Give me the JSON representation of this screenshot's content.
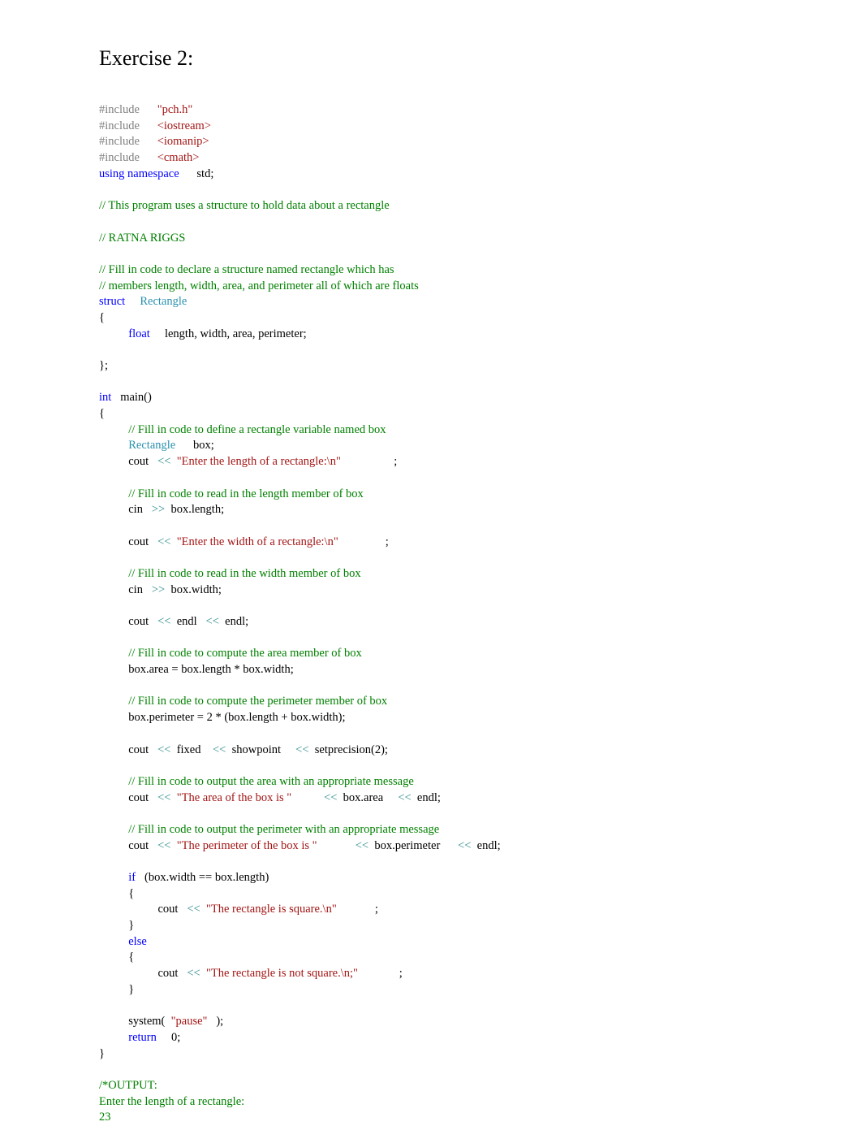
{
  "document": {
    "title": "Exercise 2:",
    "language": "cpp",
    "background_color": "#ffffff"
  },
  "syntax_colors": {
    "preprocessor": "#808080",
    "string": "#A31515",
    "keyword": "#0000FF",
    "type": "#2B91AF",
    "comment": "#008000",
    "operator": "#2E8B8B",
    "plain": "#000000"
  },
  "code": {
    "lines": [
      {
        "tokens": [
          {
            "t": "#include",
            "c": "pre"
          },
          {
            "t": "      ",
            "c": "plain"
          },
          {
            "t": "\"pch.h\"",
            "c": "str"
          }
        ]
      },
      {
        "tokens": [
          {
            "t": "#include",
            "c": "pre"
          },
          {
            "t": "      ",
            "c": "plain"
          },
          {
            "t": "<iostream>",
            "c": "str"
          }
        ]
      },
      {
        "tokens": [
          {
            "t": "#include",
            "c": "pre"
          },
          {
            "t": "      ",
            "c": "plain"
          },
          {
            "t": "<iomanip>",
            "c": "str"
          }
        ]
      },
      {
        "tokens": [
          {
            "t": "#include",
            "c": "pre"
          },
          {
            "t": "      ",
            "c": "plain"
          },
          {
            "t": "<cmath>",
            "c": "str"
          }
        ]
      },
      {
        "tokens": [
          {
            "t": "using namespace",
            "c": "kw"
          },
          {
            "t": "      ",
            "c": "plain"
          },
          {
            "t": "std;",
            "c": "plain"
          }
        ]
      },
      {
        "tokens": []
      },
      {
        "tokens": [
          {
            "t": "// This program uses a structure to hold data about a rectangle",
            "c": "cmt"
          }
        ]
      },
      {
        "tokens": []
      },
      {
        "tokens": [
          {
            "t": "// RATNA RIGGS",
            "c": "cmt"
          }
        ]
      },
      {
        "tokens": []
      },
      {
        "tokens": [
          {
            "t": "// Fill in code to declare a structure named rectangle which has",
            "c": "cmt"
          }
        ]
      },
      {
        "tokens": [
          {
            "t": "// members length, width, area, and perimeter all of which are floats",
            "c": "cmt"
          }
        ]
      },
      {
        "tokens": [
          {
            "t": "struct",
            "c": "kw"
          },
          {
            "t": "     ",
            "c": "plain"
          },
          {
            "t": "Rectangle",
            "c": "type"
          }
        ]
      },
      {
        "tokens": [
          {
            "t": "{",
            "c": "plain"
          }
        ]
      },
      {
        "tokens": [
          {
            "t": "          ",
            "c": "plain"
          },
          {
            "t": "float",
            "c": "kw"
          },
          {
            "t": "     ",
            "c": "plain"
          },
          {
            "t": "length, width, area, perimeter;",
            "c": "plain"
          }
        ]
      },
      {
        "tokens": []
      },
      {
        "tokens": [
          {
            "t": "};",
            "c": "plain"
          }
        ]
      },
      {
        "tokens": []
      },
      {
        "tokens": [
          {
            "t": "int",
            "c": "kw"
          },
          {
            "t": "   ",
            "c": "plain"
          },
          {
            "t": "main()",
            "c": "plain"
          }
        ]
      },
      {
        "tokens": [
          {
            "t": "{",
            "c": "plain"
          }
        ]
      },
      {
        "tokens": [
          {
            "t": "          ",
            "c": "plain"
          },
          {
            "t": "// Fill in code to define a rectangle variable named box",
            "c": "cmt"
          }
        ]
      },
      {
        "tokens": [
          {
            "t": "          ",
            "c": "plain"
          },
          {
            "t": "Rectangle",
            "c": "type"
          },
          {
            "t": "      ",
            "c": "plain"
          },
          {
            "t": "box;",
            "c": "plain"
          }
        ]
      },
      {
        "tokens": [
          {
            "t": "          ",
            "c": "plain"
          },
          {
            "t": "cout",
            "c": "plain"
          },
          {
            "t": "   ",
            "c": "plain"
          },
          {
            "t": "<<",
            "c": "op"
          },
          {
            "t": "  ",
            "c": "plain"
          },
          {
            "t": "\"Enter the length of a rectangle:\\n\"",
            "c": "str"
          },
          {
            "t": "                  ",
            "c": "plain"
          },
          {
            "t": ";",
            "c": "plain"
          }
        ]
      },
      {
        "tokens": []
      },
      {
        "tokens": [
          {
            "t": "          ",
            "c": "plain"
          },
          {
            "t": "// Fill in code to read in the length member of box",
            "c": "cmt"
          }
        ]
      },
      {
        "tokens": [
          {
            "t": "          ",
            "c": "plain"
          },
          {
            "t": "cin",
            "c": "plain"
          },
          {
            "t": "   ",
            "c": "plain"
          },
          {
            "t": ">>",
            "c": "op"
          },
          {
            "t": "  ",
            "c": "plain"
          },
          {
            "t": "box.length;",
            "c": "plain"
          }
        ]
      },
      {
        "tokens": []
      },
      {
        "tokens": [
          {
            "t": "          ",
            "c": "plain"
          },
          {
            "t": "cout",
            "c": "plain"
          },
          {
            "t": "   ",
            "c": "plain"
          },
          {
            "t": "<<",
            "c": "op"
          },
          {
            "t": "  ",
            "c": "plain"
          },
          {
            "t": "\"Enter the width of a rectangle:\\n\"",
            "c": "str"
          },
          {
            "t": "                ",
            "c": "plain"
          },
          {
            "t": ";",
            "c": "plain"
          }
        ]
      },
      {
        "tokens": []
      },
      {
        "tokens": [
          {
            "t": "          ",
            "c": "plain"
          },
          {
            "t": "// Fill in code to read in the width member of box",
            "c": "cmt"
          }
        ]
      },
      {
        "tokens": [
          {
            "t": "          ",
            "c": "plain"
          },
          {
            "t": "cin",
            "c": "plain"
          },
          {
            "t": "   ",
            "c": "plain"
          },
          {
            "t": ">>",
            "c": "op"
          },
          {
            "t": "  ",
            "c": "plain"
          },
          {
            "t": "box.width;",
            "c": "plain"
          }
        ]
      },
      {
        "tokens": []
      },
      {
        "tokens": [
          {
            "t": "          ",
            "c": "plain"
          },
          {
            "t": "cout",
            "c": "plain"
          },
          {
            "t": "   ",
            "c": "plain"
          },
          {
            "t": "<<",
            "c": "op"
          },
          {
            "t": "  ",
            "c": "plain"
          },
          {
            "t": "endl",
            "c": "plain"
          },
          {
            "t": "   ",
            "c": "plain"
          },
          {
            "t": "<<",
            "c": "op"
          },
          {
            "t": "  ",
            "c": "plain"
          },
          {
            "t": "endl;",
            "c": "plain"
          }
        ]
      },
      {
        "tokens": []
      },
      {
        "tokens": [
          {
            "t": "          ",
            "c": "plain"
          },
          {
            "t": "// Fill in code to compute the area member of box",
            "c": "cmt"
          }
        ]
      },
      {
        "tokens": [
          {
            "t": "          ",
            "c": "plain"
          },
          {
            "t": "box.area = box.length * box.width;",
            "c": "plain"
          }
        ]
      },
      {
        "tokens": []
      },
      {
        "tokens": [
          {
            "t": "          ",
            "c": "plain"
          },
          {
            "t": "// Fill in code to compute the perimeter member of box",
            "c": "cmt"
          }
        ]
      },
      {
        "tokens": [
          {
            "t": "          ",
            "c": "plain"
          },
          {
            "t": "box.perimeter = 2 * (box.length + box.width);",
            "c": "plain"
          }
        ]
      },
      {
        "tokens": []
      },
      {
        "tokens": [
          {
            "t": "          ",
            "c": "plain"
          },
          {
            "t": "cout",
            "c": "plain"
          },
          {
            "t": "   ",
            "c": "plain"
          },
          {
            "t": "<<",
            "c": "op"
          },
          {
            "t": "  ",
            "c": "plain"
          },
          {
            "t": "fixed",
            "c": "plain"
          },
          {
            "t": "    ",
            "c": "plain"
          },
          {
            "t": "<<",
            "c": "op"
          },
          {
            "t": "  ",
            "c": "plain"
          },
          {
            "t": "showpoint",
            "c": "plain"
          },
          {
            "t": "     ",
            "c": "plain"
          },
          {
            "t": "<<",
            "c": "op"
          },
          {
            "t": "  ",
            "c": "plain"
          },
          {
            "t": "setprecision(2);",
            "c": "plain"
          }
        ]
      },
      {
        "tokens": []
      },
      {
        "tokens": [
          {
            "t": "          ",
            "c": "plain"
          },
          {
            "t": "// Fill in code to output the area with an appropriate message",
            "c": "cmt"
          }
        ]
      },
      {
        "tokens": [
          {
            "t": "          ",
            "c": "plain"
          },
          {
            "t": "cout",
            "c": "plain"
          },
          {
            "t": "   ",
            "c": "plain"
          },
          {
            "t": "<<",
            "c": "op"
          },
          {
            "t": "  ",
            "c": "plain"
          },
          {
            "t": "\"The area of the box is \"",
            "c": "str"
          },
          {
            "t": "           ",
            "c": "plain"
          },
          {
            "t": "<<",
            "c": "op"
          },
          {
            "t": "  ",
            "c": "plain"
          },
          {
            "t": "box.area",
            "c": "plain"
          },
          {
            "t": "     ",
            "c": "plain"
          },
          {
            "t": "<<",
            "c": "op"
          },
          {
            "t": "  ",
            "c": "plain"
          },
          {
            "t": "endl;",
            "c": "plain"
          }
        ]
      },
      {
        "tokens": []
      },
      {
        "tokens": [
          {
            "t": "          ",
            "c": "plain"
          },
          {
            "t": "// Fill in code to output the perimeter with an appropriate message",
            "c": "cmt"
          }
        ]
      },
      {
        "tokens": [
          {
            "t": "          ",
            "c": "plain"
          },
          {
            "t": "cout",
            "c": "plain"
          },
          {
            "t": "   ",
            "c": "plain"
          },
          {
            "t": "<<",
            "c": "op"
          },
          {
            "t": "  ",
            "c": "plain"
          },
          {
            "t": "\"The perimeter of the box is \"",
            "c": "str"
          },
          {
            "t": "             ",
            "c": "plain"
          },
          {
            "t": "<<",
            "c": "op"
          },
          {
            "t": "  ",
            "c": "plain"
          },
          {
            "t": "box.perimeter",
            "c": "plain"
          },
          {
            "t": "      ",
            "c": "plain"
          },
          {
            "t": "<<",
            "c": "op"
          },
          {
            "t": "  ",
            "c": "plain"
          },
          {
            "t": "endl;",
            "c": "plain"
          }
        ]
      },
      {
        "tokens": []
      },
      {
        "tokens": [
          {
            "t": "          ",
            "c": "plain"
          },
          {
            "t": "if",
            "c": "kw"
          },
          {
            "t": "   ",
            "c": "plain"
          },
          {
            "t": "(box.width == box.length)",
            "c": "plain"
          }
        ]
      },
      {
        "tokens": [
          {
            "t": "          ",
            "c": "plain"
          },
          {
            "t": "{",
            "c": "plain"
          }
        ]
      },
      {
        "tokens": [
          {
            "t": "                    ",
            "c": "plain"
          },
          {
            "t": "cout",
            "c": "plain"
          },
          {
            "t": "   ",
            "c": "plain"
          },
          {
            "t": "<<",
            "c": "op"
          },
          {
            "t": "  ",
            "c": "plain"
          },
          {
            "t": "\"The rectangle is square.\\n\"",
            "c": "str"
          },
          {
            "t": "             ",
            "c": "plain"
          },
          {
            "t": ";",
            "c": "plain"
          }
        ]
      },
      {
        "tokens": [
          {
            "t": "          ",
            "c": "plain"
          },
          {
            "t": "}",
            "c": "plain"
          }
        ]
      },
      {
        "tokens": [
          {
            "t": "          ",
            "c": "plain"
          },
          {
            "t": "else",
            "c": "kw"
          }
        ]
      },
      {
        "tokens": [
          {
            "t": "          ",
            "c": "plain"
          },
          {
            "t": "{",
            "c": "plain"
          }
        ]
      },
      {
        "tokens": [
          {
            "t": "                    ",
            "c": "plain"
          },
          {
            "t": "cout",
            "c": "plain"
          },
          {
            "t": "   ",
            "c": "plain"
          },
          {
            "t": "<<",
            "c": "op"
          },
          {
            "t": "  ",
            "c": "plain"
          },
          {
            "t": "\"The rectangle is not square.\\n;\"",
            "c": "str"
          },
          {
            "t": "              ",
            "c": "plain"
          },
          {
            "t": ";",
            "c": "plain"
          }
        ]
      },
      {
        "tokens": [
          {
            "t": "          ",
            "c": "plain"
          },
          {
            "t": "}",
            "c": "plain"
          }
        ]
      },
      {
        "tokens": []
      },
      {
        "tokens": [
          {
            "t": "          ",
            "c": "plain"
          },
          {
            "t": "system(",
            "c": "plain"
          },
          {
            "t": "  ",
            "c": "plain"
          },
          {
            "t": "\"pause\"",
            "c": "str"
          },
          {
            "t": "   ",
            "c": "plain"
          },
          {
            "t": ");",
            "c": "plain"
          }
        ]
      },
      {
        "tokens": [
          {
            "t": "          ",
            "c": "plain"
          },
          {
            "t": "return",
            "c": "kw"
          },
          {
            "t": "     ",
            "c": "plain"
          },
          {
            "t": "0;",
            "c": "plain"
          }
        ]
      },
      {
        "tokens": [
          {
            "t": "}",
            "c": "plain"
          }
        ]
      },
      {
        "tokens": []
      },
      {
        "tokens": [
          {
            "t": "/*OUTPUT:",
            "c": "cmt"
          }
        ]
      },
      {
        "tokens": [
          {
            "t": "Enter the length of a rectangle:",
            "c": "cmt"
          }
        ]
      },
      {
        "tokens": [
          {
            "t": "23",
            "c": "cmt"
          }
        ]
      }
    ]
  }
}
